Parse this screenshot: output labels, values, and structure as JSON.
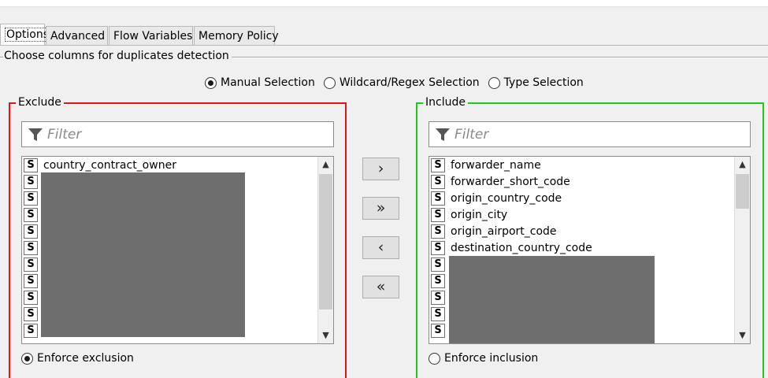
{
  "tabs": [
    {
      "label": "Options",
      "active": true
    },
    {
      "label": "Advanced",
      "active": false
    },
    {
      "label": "Flow Variables",
      "active": false
    },
    {
      "label": "Memory Policy",
      "active": false
    }
  ],
  "group_title": "Choose columns for duplicates detection",
  "selection_modes": [
    {
      "label": "Manual Selection",
      "selected": true
    },
    {
      "label": "Wildcard/Regex Selection",
      "selected": false
    },
    {
      "label": "Type Selection",
      "selected": false
    }
  ],
  "exclude": {
    "title": "Exclude",
    "filter_placeholder": "Filter",
    "type_badge": "S",
    "items": [
      "country_contract_owner"
    ],
    "enforce_label": "Enforce exclusion",
    "enforce_selected": true,
    "color": "#e0121a"
  },
  "include": {
    "title": "Include",
    "filter_placeholder": "Filter",
    "type_badge": "S",
    "items": [
      "forwarder_name",
      "forwarder_short_code",
      "origin_country_code",
      "origin_city",
      "origin_airport_code",
      "destination_country_code"
    ],
    "enforce_label": "Enforce inclusion",
    "enforce_selected": false,
    "color": "#1ec81e"
  },
  "move_buttons": [
    {
      "label": "›",
      "action": "add"
    },
    {
      "label": "»",
      "action": "add-all"
    },
    {
      "label": "‹",
      "action": "remove"
    },
    {
      "label": "«",
      "action": "remove-all"
    }
  ],
  "icons": {
    "filter": "funnel-icon",
    "scroll_up": "chevron-up-icon",
    "scroll_down": "chevron-down-icon"
  }
}
